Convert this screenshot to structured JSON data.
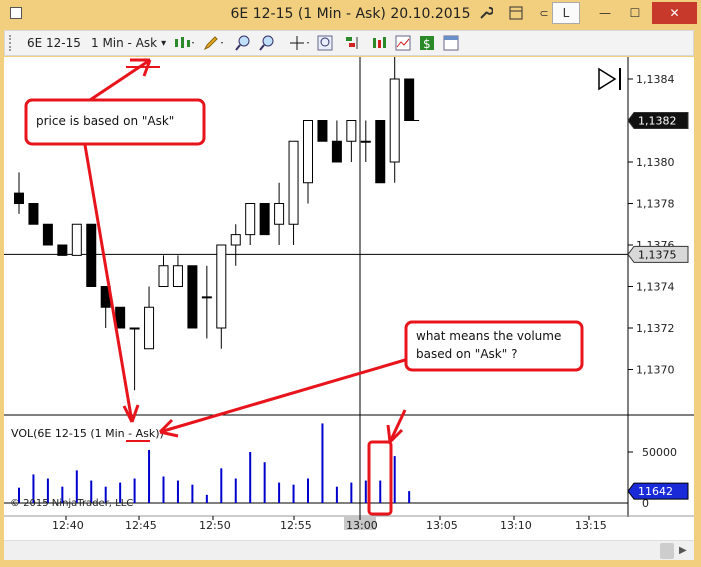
{
  "window": {
    "title": "6E 12-15 (1 Min - Ask)  20.10.2015",
    "minimize_glyph": "—",
    "maximize_glyph": "☐",
    "close_glyph": "✕",
    "link_label": "L"
  },
  "toolbar": {
    "instrument": "6E 12-15",
    "period": "1 Min - Ask",
    "dropdown_glyph": "▾"
  },
  "chart": {
    "price_labels": [
      "1,1384",
      "1,1382",
      "1,1380",
      "1,1378",
      "1,1376",
      "1,1375",
      "1,1374",
      "1,1372",
      "1,1370"
    ],
    "current_price": "1,1382",
    "crosshair_price": "1,1375",
    "volume_title": "VOL(6E 12-15 (1 Min - Ask))",
    "volume_labels": [
      "50000",
      "0"
    ],
    "current_volume": "11642",
    "time_labels": [
      "12:40",
      "12:45",
      "12:50",
      "12:55",
      "13:00",
      "13:05",
      "13:10",
      "13:15"
    ],
    "copyright": "© 2015 NinjaTrader, LLC",
    "colors": {
      "up": "#ffffff",
      "down": "#000000",
      "volume": "#0000cc",
      "annotation": "#e8141c"
    }
  },
  "annotations": {
    "note1": "price is based on \"Ask\"",
    "note2_line1": "what means the volume",
    "note2_line2": "based on \"Ask\" ?"
  },
  "chart_data": {
    "type": "candlestick",
    "time_axis": [
      "12:40",
      "12:45",
      "12:50",
      "12:55",
      "13:00",
      "13:05",
      "13:10",
      "13:15"
    ],
    "price_range": [
      1.1368,
      1.1386
    ],
    "candles": [
      {
        "o": 1.13785,
        "h": 1.13795,
        "l": 1.13775,
        "c": 1.1378
      },
      {
        "o": 1.1378,
        "h": 1.1378,
        "l": 1.1377,
        "c": 1.1377
      },
      {
        "o": 1.1377,
        "h": 1.1377,
        "l": 1.1376,
        "c": 1.1376
      },
      {
        "o": 1.1376,
        "h": 1.1376,
        "l": 1.13755,
        "c": 1.13755
      },
      {
        "o": 1.13755,
        "h": 1.1377,
        "l": 1.13755,
        "c": 1.1377
      },
      {
        "o": 1.1377,
        "h": 1.1377,
        "l": 1.1374,
        "c": 1.1374
      },
      {
        "o": 1.1374,
        "h": 1.1374,
        "l": 1.1372,
        "c": 1.1373
      },
      {
        "o": 1.1373,
        "h": 1.1373,
        "l": 1.1372,
        "c": 1.1372
      },
      {
        "o": 1.1372,
        "h": 1.1372,
        "l": 1.1369,
        "c": 1.1372
      },
      {
        "o": 1.1371,
        "h": 1.1374,
        "l": 1.1371,
        "c": 1.1373
      },
      {
        "o": 1.1374,
        "h": 1.13755,
        "l": 1.1374,
        "c": 1.1375
      },
      {
        "o": 1.1374,
        "h": 1.13755,
        "l": 1.1374,
        "c": 1.1375
      },
      {
        "o": 1.1375,
        "h": 1.1375,
        "l": 1.1372,
        "c": 1.1372
      },
      {
        "o": 1.13735,
        "h": 1.1375,
        "l": 1.13715,
        "c": 1.13735
      },
      {
        "o": 1.1372,
        "h": 1.1376,
        "l": 1.1371,
        "c": 1.1376
      },
      {
        "o": 1.1376,
        "h": 1.1377,
        "l": 1.1375,
        "c": 1.13765
      },
      {
        "o": 1.13765,
        "h": 1.1378,
        "l": 1.1376,
        "c": 1.1378
      },
      {
        "o": 1.1378,
        "h": 1.1378,
        "l": 1.13765,
        "c": 1.13765
      },
      {
        "o": 1.1377,
        "h": 1.1379,
        "l": 1.1376,
        "c": 1.1378
      },
      {
        "o": 1.1377,
        "h": 1.1381,
        "l": 1.1376,
        "c": 1.1381
      },
      {
        "o": 1.1379,
        "h": 1.1382,
        "l": 1.1378,
        "c": 1.1382
      },
      {
        "o": 1.1382,
        "h": 1.1382,
        "l": 1.1381,
        "c": 1.1381
      },
      {
        "o": 1.1381,
        "h": 1.1382,
        "l": 1.138,
        "c": 1.138
      },
      {
        "o": 1.1381,
        "h": 1.1382,
        "l": 1.138,
        "c": 1.1382
      },
      {
        "o": 1.1381,
        "h": 1.1382,
        "l": 1.138,
        "c": 1.1381
      },
      {
        "o": 1.1382,
        "h": 1.1382,
        "l": 1.1379,
        "c": 1.1379
      },
      {
        "o": 1.138,
        "h": 1.1386,
        "l": 1.1379,
        "c": 1.1384
      },
      {
        "o": 1.1384,
        "h": 1.1384,
        "l": 1.1382,
        "c": 1.1382
      }
    ],
    "volume_range": [
      0,
      80000
    ],
    "volumes": [
      15000,
      28000,
      24000,
      16000,
      32000,
      22000,
      16000,
      20000,
      24000,
      52000,
      26000,
      22000,
      18000,
      8000,
      34000,
      24000,
      50000,
      40000,
      20000,
      18000,
      24000,
      78000,
      16000,
      20000,
      22000,
      22000,
      46000,
      11642
    ]
  }
}
